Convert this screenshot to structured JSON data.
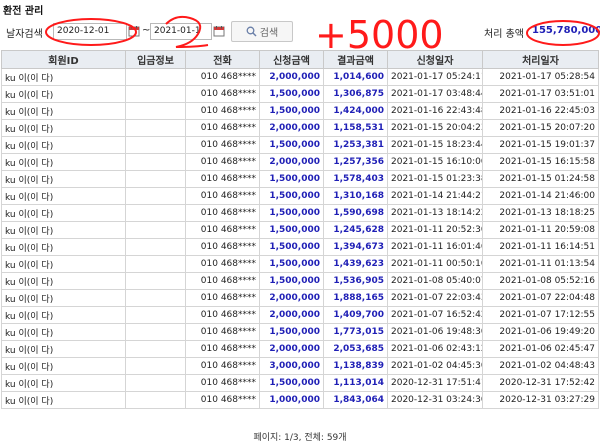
{
  "page": {
    "title": "환전 관리"
  },
  "filter": {
    "date_label": "날자검색",
    "start_date": "2020-12-01",
    "separator": "~",
    "end_date": "2021-01-1",
    "search_label": "검색",
    "total_label": "처리 총액",
    "total_value": "155,780,000",
    "annotation_text": "+5000"
  },
  "table": {
    "headers": [
      "회원ID",
      "입금정보",
      "전화",
      "신청금액",
      "결과금액",
      "신청일자",
      "처리일자"
    ],
    "rows": [
      {
        "id": "ku             이(이     다)",
        "deposit": "",
        "phone": "010 468****",
        "request": "2,000,000",
        "result": "1,014,600",
        "requested_at": "2021-01-17 05:24:11",
        "processed_at": "2021-01-17 05:28:54"
      },
      {
        "id": "ku             이(이     다)",
        "deposit": "",
        "phone": "010 468****",
        "request": "1,500,000",
        "result": "1,306,875",
        "requested_at": "2021-01-17 03:48:44",
        "processed_at": "2021-01-17 03:51:01"
      },
      {
        "id": "ku             이(이     다)",
        "deposit": "",
        "phone": "010 468****",
        "request": "1,500,000",
        "result": "1,424,000",
        "requested_at": "2021-01-16 22:43:48",
        "processed_at": "2021-01-16 22:45:03"
      },
      {
        "id": "ku             이(이     다)",
        "deposit": "",
        "phone": "010 468****",
        "request": "2,000,000",
        "result": "1,158,531",
        "requested_at": "2021-01-15 20:04:23",
        "processed_at": "2021-01-15 20:07:20"
      },
      {
        "id": "ku             이(이     다)",
        "deposit": "",
        "phone": "010 468****",
        "request": "1,500,000",
        "result": "1,253,381",
        "requested_at": "2021-01-15 18:23:44",
        "processed_at": "2021-01-15 19:01:37"
      },
      {
        "id": "ku             이(이     다)",
        "deposit": "",
        "phone": "010 468****",
        "request": "2,000,000",
        "result": "1,257,356",
        "requested_at": "2021-01-15 16:10:00",
        "processed_at": "2021-01-15 16:15:58"
      },
      {
        "id": "ku             이(이     다)",
        "deposit": "",
        "phone": "010 468****",
        "request": "1,500,000",
        "result": "1,578,403",
        "requested_at": "2021-01-15 01:23:38",
        "processed_at": "2021-01-15 01:24:58"
      },
      {
        "id": "ku             이(이     다)",
        "deposit": "",
        "phone": "010 468****",
        "request": "1,500,000",
        "result": "1,310,168",
        "requested_at": "2021-01-14 21:44:21",
        "processed_at": "2021-01-14 21:46:00"
      },
      {
        "id": "ku             이(이     다)",
        "deposit": "",
        "phone": "010 468****",
        "request": "1,500,000",
        "result": "1,590,698",
        "requested_at": "2021-01-13 18:14:22",
        "processed_at": "2021-01-13 18:18:25"
      },
      {
        "id": "ku             이(이     다)",
        "deposit": "",
        "phone": "010 468****",
        "request": "1,500,000",
        "result": "1,245,628",
        "requested_at": "2021-01-11 20:52:30",
        "processed_at": "2021-01-11 20:59:08"
      },
      {
        "id": "ku             이(이     다)",
        "deposit": "",
        "phone": "010 468****",
        "request": "1,500,000",
        "result": "1,394,673",
        "requested_at": "2021-01-11 16:01:46",
        "processed_at": "2021-01-11 16:14:51"
      },
      {
        "id": "ku             이(이     다)",
        "deposit": "",
        "phone": "010 468****",
        "request": "1,500,000",
        "result": "1,439,623",
        "requested_at": "2021-01-11 00:50:10",
        "processed_at": "2021-01-11 01:13:54"
      },
      {
        "id": "ku             이(이     다)",
        "deposit": "",
        "phone": "010 468****",
        "request": "1,500,000",
        "result": "1,536,905",
        "requested_at": "2021-01-08 05:40:07",
        "processed_at": "2021-01-08 05:52:16"
      },
      {
        "id": "ku             이(이     다)",
        "deposit": "",
        "phone": "010 468****",
        "request": "2,000,000",
        "result": "1,888,165",
        "requested_at": "2021-01-07 22:03:43",
        "processed_at": "2021-01-07 22:04:48"
      },
      {
        "id": "ku             이(이     다)",
        "deposit": "",
        "phone": "010 468****",
        "request": "2,000,000",
        "result": "1,409,700",
        "requested_at": "2021-01-07 16:52:42",
        "processed_at": "2021-01-07 17:12:55"
      },
      {
        "id": "ku             이(이     다)",
        "deposit": "",
        "phone": "010 468****",
        "request": "1,500,000",
        "result": "1,773,015",
        "requested_at": "2021-01-06 19:48:30",
        "processed_at": "2021-01-06 19:49:20"
      },
      {
        "id": "ku             이(이     다)",
        "deposit": "",
        "phone": "010 468****",
        "request": "2,000,000",
        "result": "2,053,685",
        "requested_at": "2021-01-06 02:43:12",
        "processed_at": "2021-01-06 02:45:47"
      },
      {
        "id": "ku             이(이     다)",
        "deposit": "",
        "phone": "010 468****",
        "request": "3,000,000",
        "result": "1,138,839",
        "requested_at": "2021-01-02 04:45:30",
        "processed_at": "2021-01-02 04:48:43"
      },
      {
        "id": "ku             이(이     다)",
        "deposit": "",
        "phone": "010 468****",
        "request": "1,500,000",
        "result": "1,113,014",
        "requested_at": "2020-12-31 17:51:41",
        "processed_at": "2020-12-31 17:52:42"
      },
      {
        "id": "ku             이(이     다)",
        "deposit": "",
        "phone": "010 468****",
        "request": "1,000,000",
        "result": "1,843,064",
        "requested_at": "2020-12-31 03:24:30",
        "processed_at": "2020-12-31 03:27:29"
      }
    ]
  },
  "pagination": {
    "text": "페이지: 1/3, 전체: 59개"
  },
  "colors": {
    "amount_text": "#1f1fb6",
    "annotation": "#ff1a1a",
    "header_bg": "#e9edf2"
  }
}
